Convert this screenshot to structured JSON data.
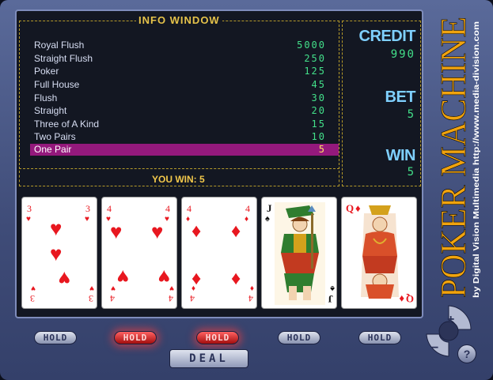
{
  "info": {
    "title": "INFO WINDOW",
    "paytable": [
      {
        "hand": "Royal Flush",
        "pays": "5000"
      },
      {
        "hand": "Straight Flush",
        "pays": "250"
      },
      {
        "hand": "Poker",
        "pays": "125"
      },
      {
        "hand": "Full House",
        "pays": "45"
      },
      {
        "hand": "Flush",
        "pays": "30"
      },
      {
        "hand": "Straight",
        "pays": "20"
      },
      {
        "hand": "Three of A Kind",
        "pays": "15"
      },
      {
        "hand": "Two Pairs",
        "pays": "10"
      },
      {
        "hand": "One Pair",
        "pays": "5"
      }
    ],
    "highlighted_hand": "One Pair",
    "highlight_color": "#94197c",
    "you_win": "YOU WIN: 5"
  },
  "stats": {
    "credit_label": "CREDIT",
    "credit": "990",
    "bet_label": "BET",
    "bet": "5",
    "win_label": "WIN",
    "win": "5"
  },
  "brand": {
    "title": "POKER MACHINE",
    "subtitle": "by Digital Vision Multimedia http://www.media-division.com",
    "title_color": "#f0a30e"
  },
  "cards": [
    {
      "rank": "3",
      "suit": "hearts",
      "suit_symbol": "♥",
      "color": "#e8171f",
      "held": false
    },
    {
      "rank": "4",
      "suit": "hearts",
      "suit_symbol": "♥",
      "color": "#e8171f",
      "held": true
    },
    {
      "rank": "4",
      "suit": "diamonds",
      "suit_symbol": "♦",
      "color": "#e8171f",
      "held": true
    },
    {
      "rank": "J",
      "suit": "spades",
      "suit_symbol": "♠",
      "color": "#111111",
      "held": false
    },
    {
      "rank": "Q",
      "suit": "diamonds",
      "suit_symbol": "♦",
      "color": "#e8171f",
      "held": false
    }
  ],
  "controls": {
    "hold_label": "HOLD",
    "deal_label": "DEAL",
    "plus_label": "+",
    "minus_label": "−",
    "help_label": "?"
  },
  "colors": {
    "panel": "#3f4c78",
    "screen": "#131722",
    "credit_text": "#7fd0ff",
    "value_text": "#43e08a",
    "gold": "#f2c84b",
    "hold_active": "#c4161c"
  }
}
